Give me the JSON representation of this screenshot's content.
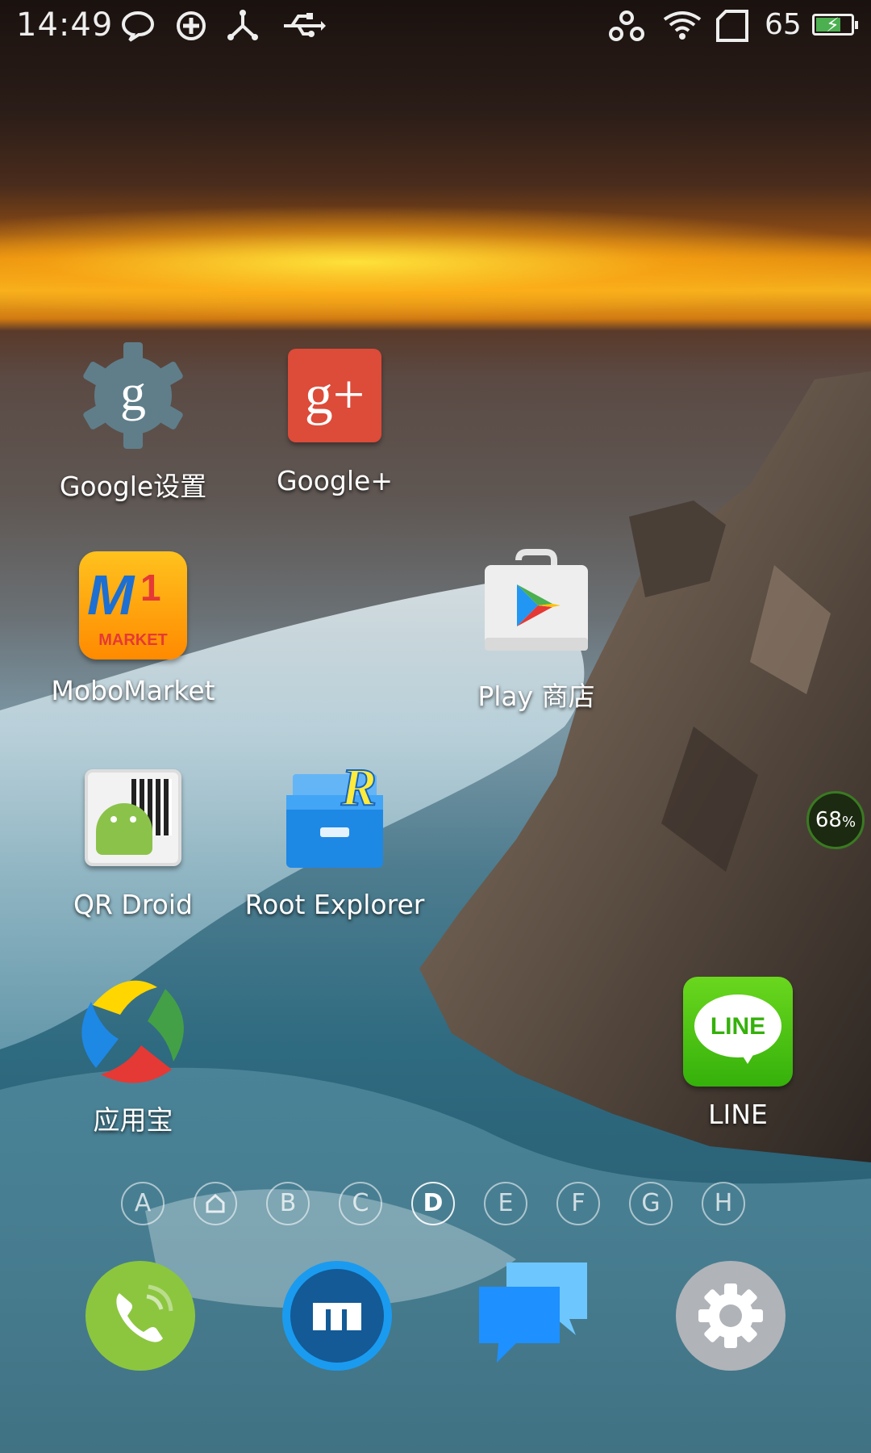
{
  "status_bar": {
    "time": "14:49",
    "left_icons": [
      "chat-bubble-icon",
      "sync-icon",
      "share-nodes-icon",
      "usb-icon"
    ],
    "right_icons": [
      "bluetooth-like-icon",
      "wifi-icon",
      "no-sim-icon"
    ],
    "battery_level": "65",
    "battery_charging": true
  },
  "apps": [
    {
      "id": "google-settings",
      "label": "Google设置",
      "icon_text": "g"
    },
    {
      "id": "google-plus",
      "label": "Google+",
      "icon_text": "g+"
    },
    {
      "id": "mobomarket",
      "label": "MoboMarket",
      "icon_text": "MARKET"
    },
    {
      "id": "play-store",
      "label": "Play 商店"
    },
    {
      "id": "qr-droid",
      "label": "QR Droid"
    },
    {
      "id": "root-explorer",
      "label": "Root Explorer",
      "icon_text": "R"
    },
    {
      "id": "yingyongbao",
      "label": "应用宝"
    },
    {
      "id": "line",
      "label": "LINE",
      "icon_text": "LINE"
    }
  ],
  "memory_widget": {
    "value": "68",
    "unit": "%"
  },
  "pager": {
    "items": [
      "A",
      "home-icon",
      "B",
      "C",
      "D",
      "E",
      "F",
      "G",
      "H"
    ],
    "labels": {
      "a": "A",
      "b": "B",
      "c": "C",
      "d": "D",
      "e": "E",
      "f": "F",
      "g": "G",
      "h": "H"
    },
    "active": "D"
  },
  "dock": [
    "phone-icon",
    "mx-launcher-icon",
    "messages-icon",
    "settings-icon"
  ],
  "colors": {
    "phone": "#8cc63f",
    "launcher": "#1f6fb0",
    "messages": "#2196f3",
    "settings": "#b0b3b8",
    "google_settings": "#5f7e8a",
    "google_plus": "#dd4b39",
    "line": "#4cc613"
  }
}
